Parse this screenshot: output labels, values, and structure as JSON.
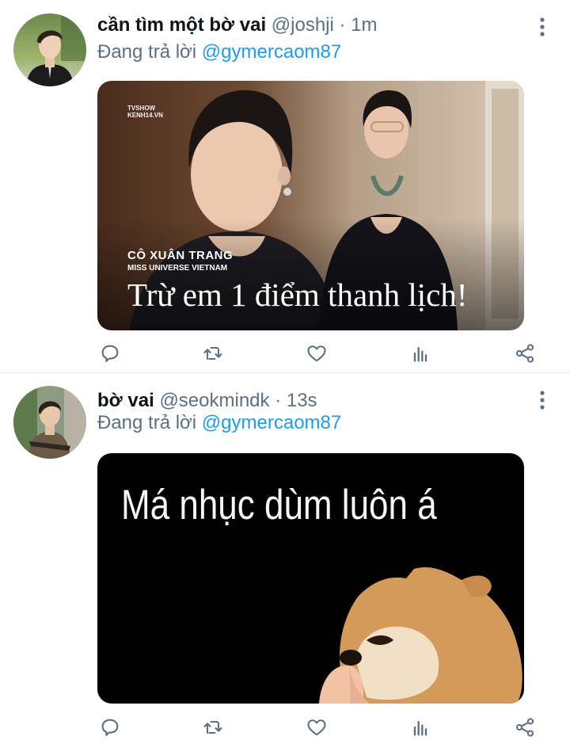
{
  "tweets": [
    {
      "display_name": "cần tìm một bờ vai",
      "handle": "@joshji",
      "separator": "·",
      "time": "1m",
      "reply_prefix": "Đang trả lời",
      "reply_to": "@gymercaom87",
      "media": {
        "watermark_line1": "TVSHOW",
        "watermark_line2": "KENH14.VN",
        "caption_name": "CÔ XUÂN TRANG",
        "caption_title": "MISS UNIVERSE VIETNAM",
        "caption_main": "Trừ em 1 điểm thanh lịch!"
      }
    },
    {
      "display_name": "bờ vai",
      "handle": "@seokmindk",
      "separator": "·",
      "time": "13s",
      "reply_prefix": "Đang trả lời",
      "reply_to": "@gymercaom87",
      "media": {
        "caption_main": "Má nhục dùm luôn á"
      }
    }
  ],
  "icons": {
    "reply": "reply-icon",
    "retweet": "retweet-icon",
    "like": "heart-icon",
    "analytics": "analytics-icon",
    "share": "share-icon",
    "more": "more-vertical-icon"
  },
  "colors": {
    "name": "#0f1419",
    "secondary": "#5b7083",
    "mention": "#1d9bf0"
  }
}
